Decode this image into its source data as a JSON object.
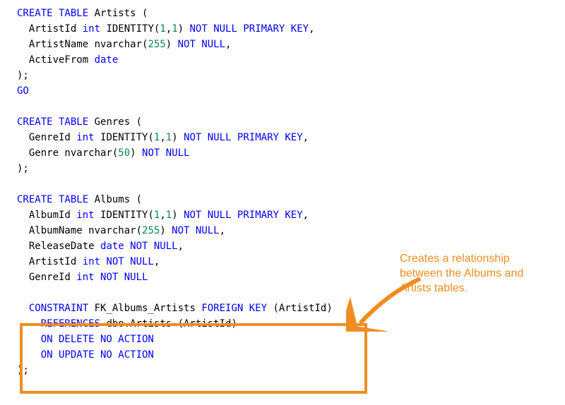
{
  "code": {
    "l1_a": "CREATE TABLE",
    "l1_b": " Artists (",
    "l2_a": "  ArtistId ",
    "l2_b": "int",
    "l2_c": " IDENTITY(",
    "l2_d": "1",
    "l2_e": ",",
    "l2_f": "1",
    "l2_g": ") ",
    "l2_h": "NOT NULL PRIMARY KEY",
    "l2_i": ",",
    "l3_a": "  ArtistName nvarchar(",
    "l3_b": "255",
    "l3_c": ") ",
    "l3_d": "NOT NULL",
    "l3_e": ",",
    "l4_a": "  ActiveFrom ",
    "l4_b": "date",
    "l5": ");",
    "l6": "GO",
    "l7": "",
    "l8_a": "CREATE TABLE",
    "l8_b": " Genres (",
    "l9_a": "  GenreId ",
    "l9_b": "int",
    "l9_c": " IDENTITY(",
    "l9_d": "1",
    "l9_e": ",",
    "l9_f": "1",
    "l9_g": ") ",
    "l9_h": "NOT NULL PRIMARY KEY",
    "l9_i": ",",
    "l10_a": "  Genre nvarchar(",
    "l10_b": "50",
    "l10_c": ") ",
    "l10_d": "NOT NULL",
    "l11": ");",
    "l12": "",
    "l13_a": "CREATE TABLE",
    "l13_b": " Albums (",
    "l14_a": "  AlbumId ",
    "l14_b": "int",
    "l14_c": " IDENTITY(",
    "l14_d": "1",
    "l14_e": ",",
    "l14_f": "1",
    "l14_g": ") ",
    "l14_h": "NOT NULL PRIMARY KEY",
    "l14_i": ",",
    "l15_a": "  AlbumName nvarchar(",
    "l15_b": "255",
    "l15_c": ") ",
    "l15_d": "NOT NULL",
    "l15_e": ",",
    "l16_a": "  ReleaseDate ",
    "l16_b": "date NOT NULL",
    "l16_c": ",",
    "l17_a": "  ArtistId ",
    "l17_b": "int NOT NULL",
    "l17_c": ",",
    "l18_a": "  GenreId ",
    "l18_b": "int NOT NULL",
    "l19": "",
    "l20_a": "  CONSTRAINT",
    "l20_b": " FK_Albums_Artists ",
    "l20_c": "FOREIGN KEY",
    "l20_d": " (ArtistId)",
    "l21_a": "    REFERENCES",
    "l21_b": " dbo.Artists (ArtistId)",
    "l22_a": "    ON DELETE NO ACTION",
    "l23_a": "    ON UPDATE NO ACTION",
    "l24": ");"
  },
  "annotation": "Creates a relationship between the Albums and Artists tables.",
  "colors": {
    "keyword": "#0000ff",
    "number": "#098658",
    "highlight": "#ef8d22"
  }
}
